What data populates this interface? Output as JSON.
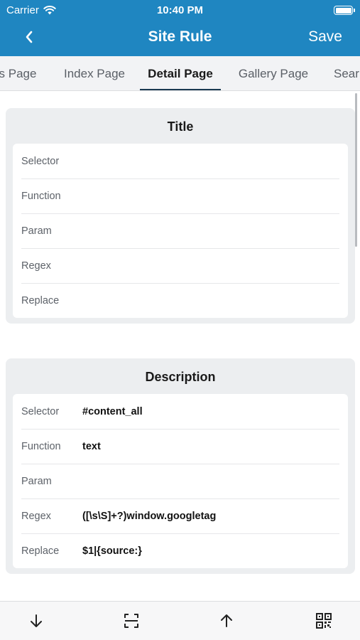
{
  "status_bar": {
    "carrier": "Carrier",
    "time": "10:40 PM",
    "wifi_icon": "wifi-icon",
    "battery_icon": "battery-icon"
  },
  "nav": {
    "back_icon": "chevron-left-icon",
    "title": "Site Rule",
    "save_label": "Save"
  },
  "tabs": [
    {
      "label": "s Page",
      "active": false
    },
    {
      "label": "Index Page",
      "active": false
    },
    {
      "label": "Detail Page",
      "active": true
    },
    {
      "label": "Gallery Page",
      "active": false
    },
    {
      "label": "Sear",
      "active": false
    }
  ],
  "sections": [
    {
      "title": "Title",
      "fields": [
        {
          "label": "Selector",
          "value": ""
        },
        {
          "label": "Function",
          "value": ""
        },
        {
          "label": "Param",
          "value": ""
        },
        {
          "label": "Regex",
          "value": ""
        },
        {
          "label": "Replace",
          "value": ""
        }
      ]
    },
    {
      "title": "Description",
      "fields": [
        {
          "label": "Selector",
          "value": "#content_all"
        },
        {
          "label": "Function",
          "value": "text"
        },
        {
          "label": "Param",
          "value": ""
        },
        {
          "label": "Regex",
          "value": "([\\s\\S]+?)window.googletag"
        },
        {
          "label": "Replace",
          "value": "$1|{source:}"
        }
      ]
    }
  ],
  "toolbar": {
    "items": [
      {
        "icon": "arrow-down-icon"
      },
      {
        "icon": "scan-frame-icon"
      },
      {
        "icon": "arrow-up-icon"
      },
      {
        "icon": "qr-code-icon"
      }
    ]
  },
  "colors": {
    "accent": "#1f86c1",
    "tab_bar": "#f2f3f5",
    "card": "#eceef0",
    "tab_indicator": "#1a3a52"
  }
}
